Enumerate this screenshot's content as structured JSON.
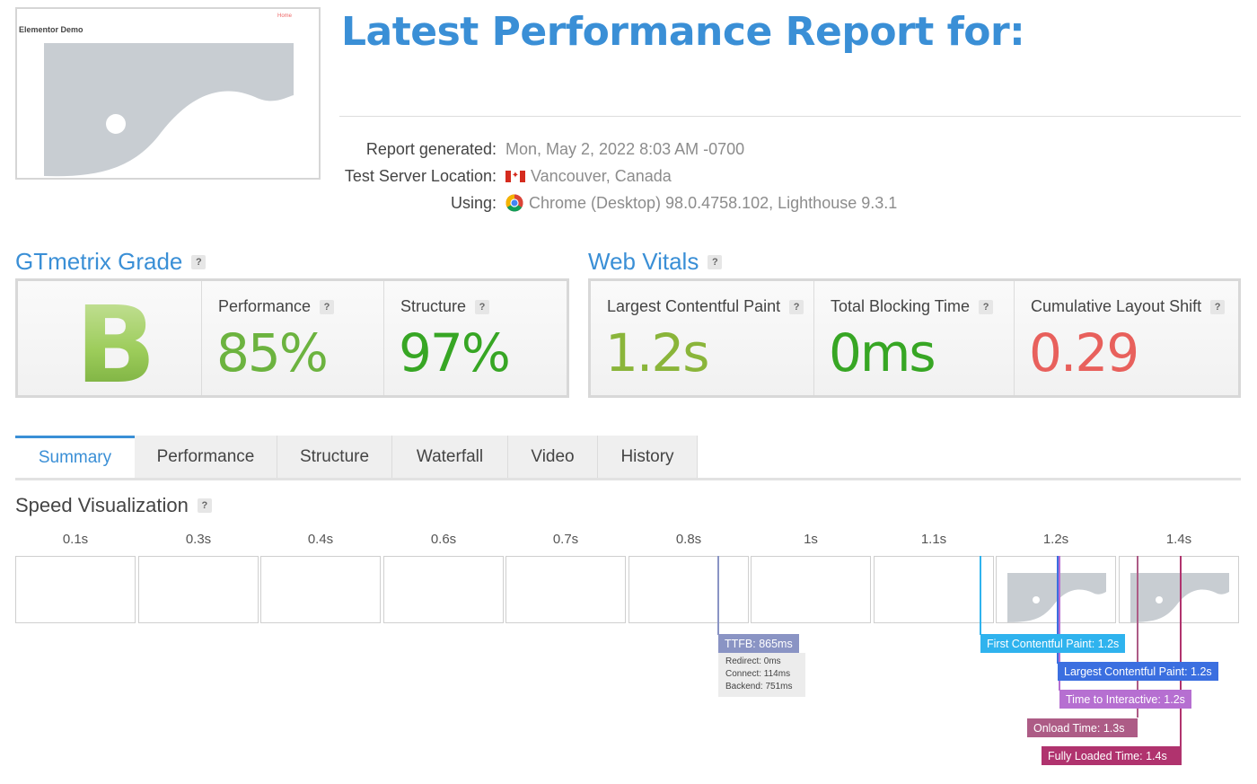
{
  "thumbnail": {
    "site_title": "Elementor Demo",
    "menu_text": "Home"
  },
  "header": {
    "title": "Latest Performance Report for:"
  },
  "meta": {
    "report_generated_label": "Report generated:",
    "report_generated_value": "Mon, May 2, 2022 8:03 AM -0700",
    "location_label": "Test Server Location:",
    "location_value": "Vancouver, Canada",
    "using_label": "Using:",
    "using_value": "Chrome (Desktop) 98.0.4758.102, Lighthouse 9.3.1"
  },
  "grade": {
    "heading": "GTmetrix Grade",
    "letter": "B",
    "performance_label": "Performance",
    "performance_value": "85%",
    "structure_label": "Structure",
    "structure_value": "97%"
  },
  "vitals": {
    "heading": "Web Vitals",
    "lcp_label": "Largest Contentful Paint",
    "lcp_value": "1.2s",
    "tbt_label": "Total Blocking Time",
    "tbt_value": "0ms",
    "cls_label": "Cumulative Layout Shift",
    "cls_value": "0.29"
  },
  "help_glyph": "?",
  "tabs": [
    {
      "label": "Summary",
      "active": true
    },
    {
      "label": "Performance",
      "active": false
    },
    {
      "label": "Structure",
      "active": false
    },
    {
      "label": "Waterfall",
      "active": false
    },
    {
      "label": "Video",
      "active": false
    },
    {
      "label": "History",
      "active": false
    }
  ],
  "speed": {
    "heading": "Speed Visualization",
    "frame_times": [
      "0.1s",
      "0.3s",
      "0.4s",
      "0.6s",
      "0.7s",
      "0.8s",
      "1s",
      "1.1s",
      "1.2s",
      "1.4s"
    ],
    "markers": {
      "ttfb": "TTFB: 865ms",
      "redirect": "Redirect: 0ms",
      "connect": "Connect: 114ms",
      "backend": "Backend: 751ms",
      "fcp": "First Contentful Paint: 1.2s",
      "lcp": "Largest Contentful Paint: 1.2s",
      "tti": "Time to Interactive: 1.2s",
      "onload": "Onload Time: 1.3s",
      "fully_loaded": "Fully Loaded Time: 1.4s"
    }
  },
  "colors": {
    "brand_blue": "#3a8fd6",
    "grade_green": "#8cc34b",
    "perf_green": "#6cb33f",
    "structure_green": "#37a624",
    "lcp_green": "#8ab53a",
    "tbt_green": "#37a624",
    "cls_red": "#e8605c",
    "ttfb": "#8a94c4",
    "fcp": "#2fb3ee",
    "lcp_marker": "#3b6fe0",
    "tti": "#b66fd1",
    "onload": "#ad5c86",
    "fully_loaded": "#b0336e"
  }
}
